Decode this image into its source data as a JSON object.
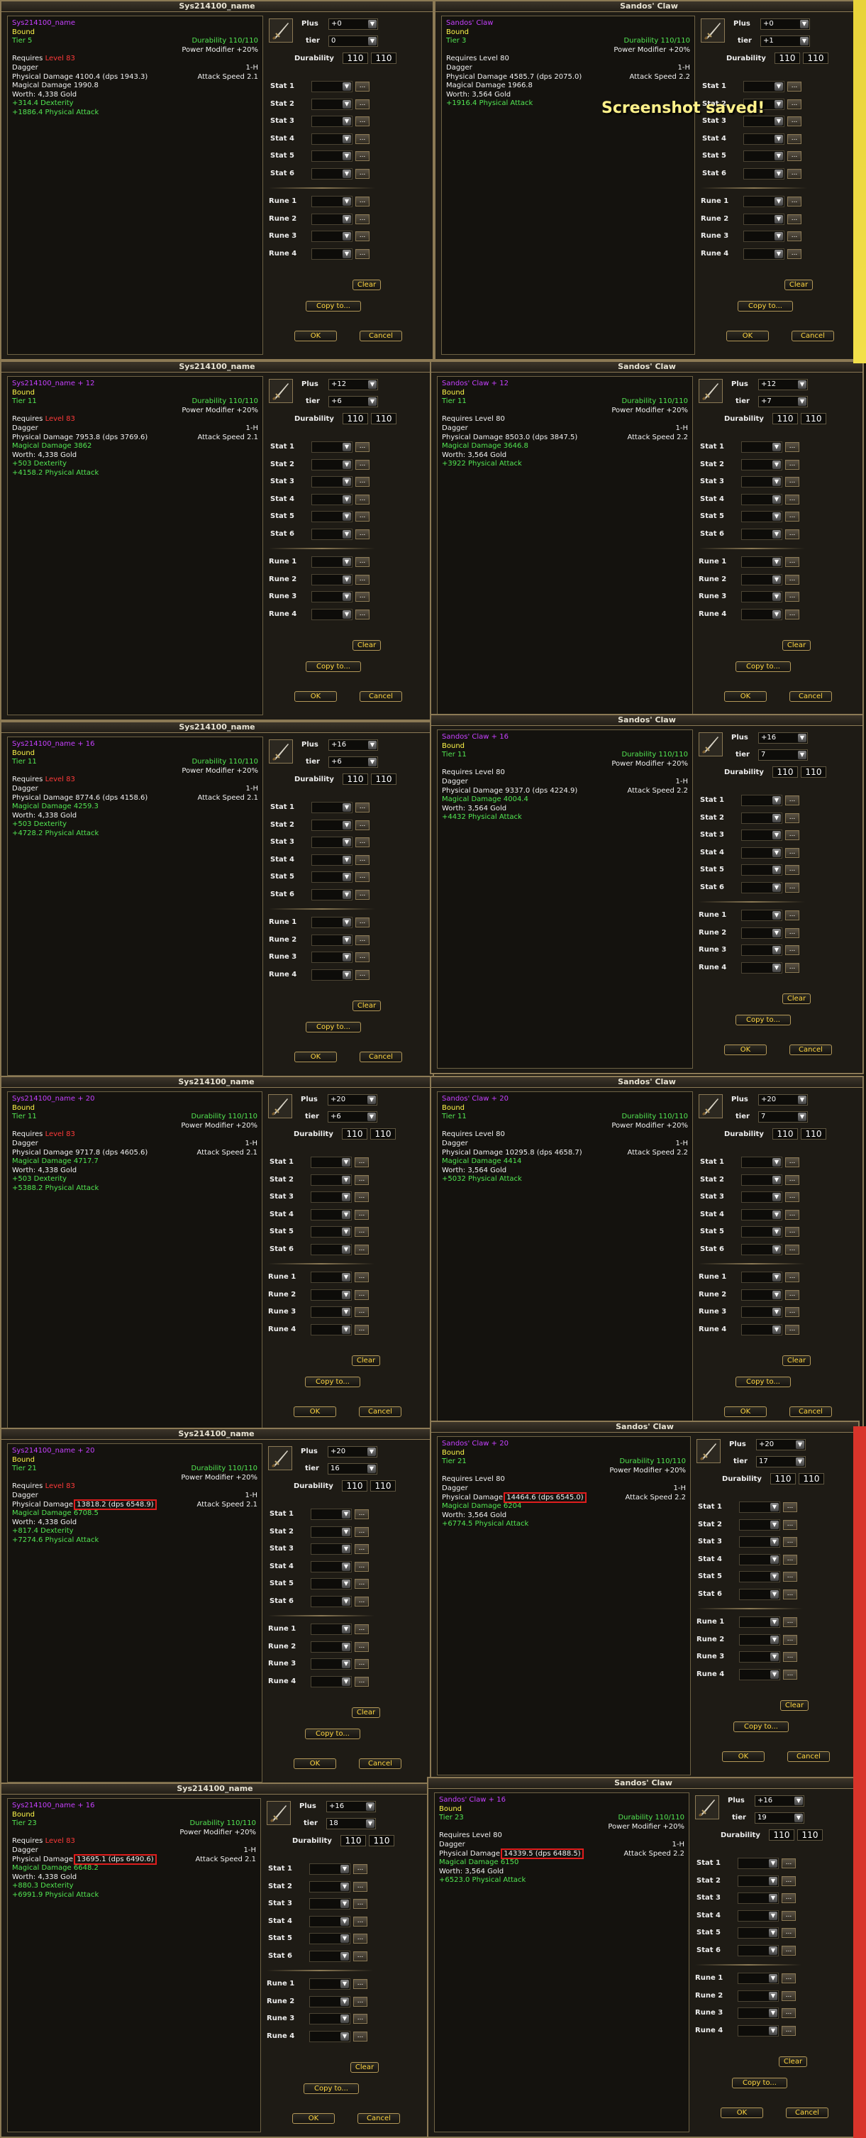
{
  "labels": {
    "plus": "Plus",
    "tier": "tier",
    "durability": "Durability",
    "stats": [
      "Stat 1",
      "Stat 2",
      "Stat 3",
      "Stat 4",
      "Stat 5",
      "Stat 6"
    ],
    "runes": [
      "Rune 1",
      "Rune 2",
      "Rune 3",
      "Rune 4"
    ],
    "clear": "Clear",
    "copy_to": "Copy to...",
    "ok": "OK",
    "cancel": "Cancel",
    "dots": "...",
    "dropdown_arrow": "▼"
  },
  "overlay": {
    "screenshot_saved": "Screenshot saved!"
  },
  "colors": {
    "item_name": "#c640ff",
    "bound": "#fff64a",
    "stat_green": "#52e652",
    "requirement_red": "#ff3a3a",
    "highlight_box": "#e01d1d"
  },
  "icons": {
    "item": "dagger-icon"
  },
  "windows": [
    {
      "id": "w1",
      "title": "Sys214100_name",
      "plus": "+0",
      "tier": "0",
      "dur_cur": "110",
      "dur_max": "110",
      "tooltip": {
        "name": "Sys214100_name",
        "bound": "Bound",
        "tier": "Tier 5",
        "durability": "Durability 110/110",
        "power_modifier": "Power Modifier +20%",
        "req_label": "Requires",
        "req_value": "Level 83",
        "req_color": "red",
        "type": "Dagger",
        "hand": "1-H",
        "phys_label": "Physical Damage",
        "phys_value": "4100.4 (dps 1943.3)",
        "phys_highlight": false,
        "speed": "Attack Speed 2.1",
        "magic_label": "Magical Damage",
        "magic_value": "1990.8",
        "magic_color": "white",
        "worth": "Worth: 4,338 Gold",
        "bonuses": [
          "+314.4 Dexterity",
          "+1886.4 Physical Attack"
        ]
      }
    },
    {
      "id": "w2",
      "title": "Sandos' Claw",
      "plus": "+0",
      "tier": "+1",
      "dur_cur": "110",
      "dur_max": "110",
      "tooltip": {
        "name": "Sandos' Claw",
        "bound": "Bound",
        "tier": "Tier 3",
        "durability": "Durability 110/110",
        "power_modifier": "Power Modifier +20%",
        "req_label": "Requires",
        "req_value": "Level 80",
        "req_color": "white",
        "type": "Dagger",
        "hand": "1-H",
        "phys_label": "Physical Damage",
        "phys_value": "4585.7 (dps 2075.0)",
        "phys_highlight": false,
        "speed": "Attack Speed 2.2",
        "magic_label": "Magical Damage",
        "magic_value": "1966.8",
        "magic_color": "white",
        "worth": "Worth: 3,564 Gold",
        "bonuses": [
          "+1916.4 Physical Attack"
        ]
      }
    },
    {
      "id": "w3",
      "title": "Sys214100_name",
      "plus": "+12",
      "tier": "+6",
      "dur_cur": "110",
      "dur_max": "110",
      "tooltip": {
        "name": "Sys214100_name + 12",
        "bound": "Bound",
        "tier": "Tier 11",
        "durability": "Durability 110/110",
        "power_modifier": "Power Modifier +20%",
        "req_label": "Requires",
        "req_value": "Level 83",
        "req_color": "red",
        "type": "Dagger",
        "hand": "1-H",
        "phys_label": "Physical Damage",
        "phys_value": "7953.8 (dps 3769.6)",
        "phys_highlight": false,
        "speed": "Attack Speed 2.1",
        "magic_label": "Magical Damage",
        "magic_value": "3862",
        "magic_color": "green",
        "worth": "Worth: 4,338 Gold",
        "bonuses": [
          "+503 Dexterity",
          "+4158.2 Physical Attack"
        ]
      }
    },
    {
      "id": "w4",
      "title": "Sandos' Claw",
      "plus": "+12",
      "tier": "+7",
      "dur_cur": "110",
      "dur_max": "110",
      "tooltip": {
        "name": "Sandos' Claw + 12",
        "bound": "Bound",
        "tier": "Tier 11",
        "durability": "Durability 110/110",
        "power_modifier": "Power Modifier +20%",
        "req_label": "Requires",
        "req_value": "Level 80",
        "req_color": "white",
        "type": "Dagger",
        "hand": "1-H",
        "phys_label": "Physical Damage",
        "phys_value": "8503.0 (dps 3847.5)",
        "phys_highlight": false,
        "speed": "Attack Speed 2.2",
        "magic_label": "Magical Damage",
        "magic_value": "3646.8",
        "magic_color": "green",
        "worth": "Worth: 3,564 Gold",
        "bonuses": [
          "+3922 Physical Attack"
        ]
      }
    },
    {
      "id": "w5",
      "title": "Sys214100_name",
      "plus": "+16",
      "tier": "+6",
      "dur_cur": "110",
      "dur_max": "110",
      "tooltip": {
        "name": "Sys214100_name + 16",
        "bound": "Bound",
        "tier": "Tier 11",
        "durability": "Durability 110/110",
        "power_modifier": "Power Modifier +20%",
        "req_label": "Requires",
        "req_value": "Level 83",
        "req_color": "red",
        "type": "Dagger",
        "hand": "1-H",
        "phys_label": "Physical Damage",
        "phys_value": "8774.6 (dps 4158.6)",
        "phys_highlight": false,
        "speed": "Attack Speed 2.1",
        "magic_label": "Magical Damage",
        "magic_value": "4259.3",
        "magic_color": "green",
        "worth": "Worth: 4,338 Gold",
        "bonuses": [
          "+503 Dexterity",
          "+4728.2 Physical Attack"
        ]
      }
    },
    {
      "id": "w6",
      "title": "Sandos' Claw",
      "plus": "+16",
      "tier": "7",
      "dur_cur": "110",
      "dur_max": "110",
      "tooltip": {
        "name": "Sandos' Claw + 16",
        "bound": "Bound",
        "tier": "Tier 11",
        "durability": "Durability 110/110",
        "power_modifier": "Power Modifier +20%",
        "req_label": "Requires",
        "req_value": "Level 80",
        "req_color": "white",
        "type": "Dagger",
        "hand": "1-H",
        "phys_label": "Physical Damage",
        "phys_value": "9337.0 (dps 4224.9)",
        "phys_highlight": false,
        "speed": "Attack Speed 2.2",
        "magic_label": "Magical Damage",
        "magic_value": "4004.4",
        "magic_color": "green",
        "worth": "Worth: 3,564 Gold",
        "bonuses": [
          "+4432 Physical Attack"
        ]
      }
    },
    {
      "id": "w7",
      "title": "Sys214100_name",
      "plus": "+20",
      "tier": "+6",
      "dur_cur": "110",
      "dur_max": "110",
      "tooltip": {
        "name": "Sys214100_name + 20",
        "bound": "Bound",
        "tier": "Tier 11",
        "durability": "Durability 110/110",
        "power_modifier": "Power Modifier +20%",
        "req_label": "Requires",
        "req_value": "Level 83",
        "req_color": "red",
        "type": "Dagger",
        "hand": "1-H",
        "phys_label": "Physical Damage",
        "phys_value": "9717.8 (dps 4605.6)",
        "phys_highlight": false,
        "speed": "Attack Speed 2.1",
        "magic_label": "Magical Damage",
        "magic_value": "4717.7",
        "magic_color": "green",
        "worth": "Worth: 4,338 Gold",
        "bonuses": [
          "+503 Dexterity",
          "+5388.2 Physical Attack"
        ]
      }
    },
    {
      "id": "w8",
      "title": "Sandos' Claw",
      "plus": "+20",
      "tier": "7",
      "dur_cur": "110",
      "dur_max": "110",
      "tooltip": {
        "name": "Sandos' Claw + 20",
        "bound": "Bound",
        "tier": "Tier 11",
        "durability": "Durability 110/110",
        "power_modifier": "Power Modifier +20%",
        "req_label": "Requires",
        "req_value": "Level 80",
        "req_color": "white",
        "type": "Dagger",
        "hand": "1-H",
        "phys_label": "Physical Damage",
        "phys_value": "10295.8 (dps 4658.7)",
        "phys_highlight": false,
        "speed": "Attack Speed 2.2",
        "magic_label": "Magical Damage",
        "magic_value": "4414",
        "magic_color": "green",
        "worth": "Worth: 3,564 Gold",
        "bonuses": [
          "+5032 Physical Attack"
        ]
      }
    },
    {
      "id": "w9",
      "title": "Sys214100_name",
      "plus": "+20",
      "tier": "16",
      "dur_cur": "110",
      "dur_max": "110",
      "tooltip": {
        "name": "Sys214100_name + 20",
        "bound": "Bound",
        "tier": "Tier 21",
        "durability": "Durability 110/110",
        "power_modifier": "Power Modifier +20%",
        "req_label": "Requires",
        "req_value": "Level 83",
        "req_color": "red",
        "type": "Dagger",
        "hand": "1-H",
        "phys_label": "Physical Damage",
        "phys_value": "13818.2 (dps 6548.9)",
        "phys_highlight": true,
        "speed": "Attack Speed 2.1",
        "magic_label": "Magical Damage",
        "magic_value": "6708.5",
        "magic_color": "green",
        "worth": "Worth: 4,338 Gold",
        "bonuses": [
          "+817.4 Dexterity",
          "+7274.6 Physical Attack"
        ]
      }
    },
    {
      "id": "w10",
      "title": "Sandos' Claw",
      "plus": "+20",
      "tier": "17",
      "dur_cur": "110",
      "dur_max": "110",
      "tooltip": {
        "name": "Sandos' Claw + 20",
        "bound": "Bound",
        "tier": "Tier 21",
        "durability": "Durability 110/110",
        "power_modifier": "Power Modifier +20%",
        "req_label": "Requires",
        "req_value": "Level 80",
        "req_color": "white",
        "type": "Dagger",
        "hand": "1-H",
        "phys_label": "Physical Damage",
        "phys_value": "14464.6 (dps 6545.0)",
        "phys_highlight": true,
        "speed": "Attack Speed 2.2",
        "magic_label": "Magical Damage",
        "magic_value": "6204",
        "magic_color": "green",
        "worth": "Worth: 3,564 Gold",
        "bonuses": [
          "+6774.5 Physical Attack"
        ]
      }
    },
    {
      "id": "w11",
      "title": "Sys214100_name",
      "plus": "+16",
      "tier": "18",
      "dur_cur": "110",
      "dur_max": "110",
      "tooltip": {
        "name": "Sys214100_name + 16",
        "bound": "Bound",
        "tier": "Tier 23",
        "durability": "Durability 110/110",
        "power_modifier": "Power Modifier +20%",
        "req_label": "Requires",
        "req_value": "Level 83",
        "req_color": "red",
        "type": "Dagger",
        "hand": "1-H",
        "phys_label": "Physical Damage",
        "phys_value": "13695.1 (dps 6490.6)",
        "phys_highlight": true,
        "speed": "Attack Speed 2.1",
        "magic_label": "Magical Damage",
        "magic_value": "6648.2",
        "magic_color": "green",
        "worth": "Worth: 4,338 Gold",
        "bonuses": [
          "+880.3 Dexterity",
          "+6991.9 Physical Attack"
        ]
      }
    },
    {
      "id": "w12",
      "title": "Sandos' Claw",
      "plus": "+16",
      "tier": "19",
      "dur_cur": "110",
      "dur_max": "110",
      "tooltip": {
        "name": "Sandos' Claw + 16",
        "bound": "Bound",
        "tier": "Tier 23",
        "durability": "Durability 110/110",
        "power_modifier": "Power Modifier +20%",
        "req_label": "Requires",
        "req_value": "Level 80",
        "req_color": "white",
        "type": "Dagger",
        "hand": "1-H",
        "phys_label": "Physical Damage",
        "phys_value": "14339.5 (dps 6488.5)",
        "phys_highlight": true,
        "speed": "Attack Speed 2.2",
        "magic_label": "Magical Damage",
        "magic_value": "6150",
        "magic_color": "green",
        "worth": "Worth: 3,564 Gold",
        "bonuses": [
          "+6523.0 Physical Attack"
        ]
      }
    }
  ]
}
